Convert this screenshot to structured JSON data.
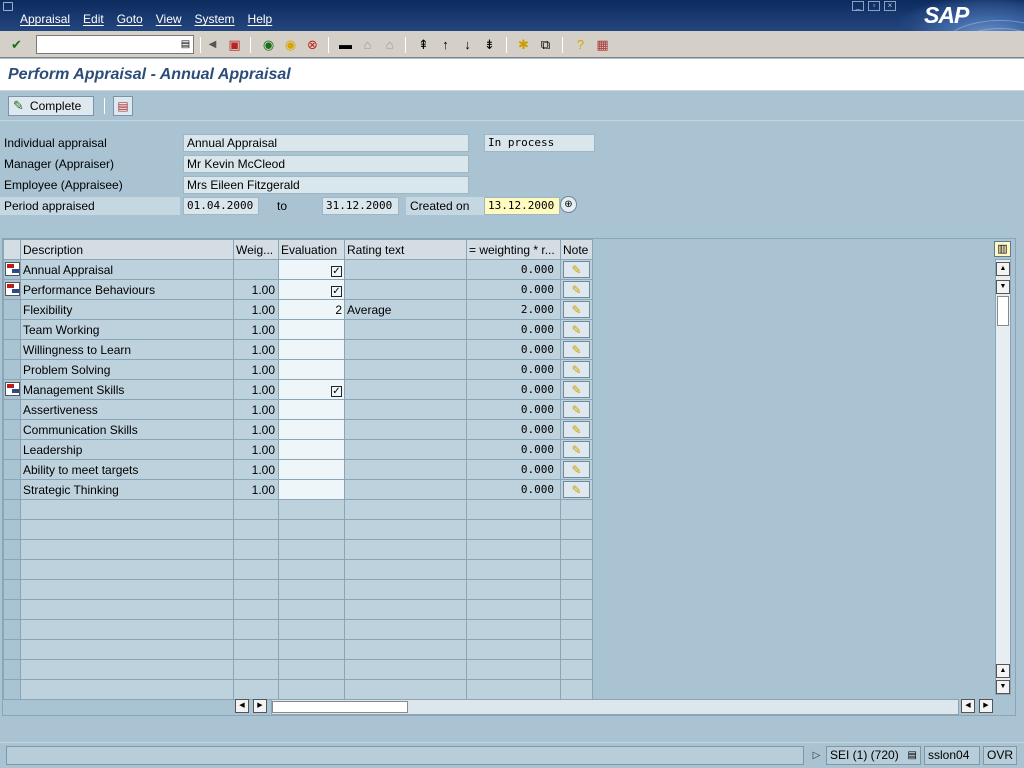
{
  "menubar": {
    "items": [
      "Appraisal",
      "Edit",
      "Goto",
      "View",
      "System",
      "Help"
    ],
    "logo_text": "SAP"
  },
  "toolbar": {
    "command_value": "",
    "icons": [
      "enter-icon",
      "history-icon",
      "back-arrow-icon",
      "save-icon",
      "back-icon",
      "exit-icon",
      "cancel-icon",
      "print-icon",
      "find-icon",
      "find-next-icon",
      "first-page-icon",
      "previous-page-icon",
      "next-page-icon",
      "last-page-icon",
      "create-session-icon",
      "shortcut-icon",
      "help-icon",
      "layout-menu-icon"
    ]
  },
  "title": "Perform Appraisal - Annual Appraisal",
  "app_toolbar": {
    "complete_label": "Complete"
  },
  "header": {
    "individual_appraisal_label": "Individual appraisal",
    "individual_appraisal_value": "Annual Appraisal",
    "status_value": "In process",
    "manager_label": "Manager (Appraiser)",
    "manager_value": "Mr Kevin McCleod",
    "employee_label": "Employee (Appraisee)",
    "employee_value": "Mrs Eileen Fitzgerald",
    "period_label": "Period appraised",
    "period_from": "01.04.2000",
    "to_label": "to",
    "period_to": "31.12.2000",
    "created_on_label": "Created on",
    "created_on_value": "13.12.2000"
  },
  "table": {
    "columns": [
      "Description",
      "Weig...",
      "Evaluation",
      "Rating text",
      "= weighting * r...",
      "Note"
    ],
    "rows": [
      {
        "has_icon": true,
        "description": "Annual Appraisal",
        "weight": "",
        "evaluation": "",
        "eval_check": true,
        "rating_text": "",
        "result": "0.000"
      },
      {
        "has_icon": true,
        "description": "Performance Behaviours",
        "weight": "1.00",
        "evaluation": "",
        "eval_check": true,
        "rating_text": "",
        "result": "0.000"
      },
      {
        "has_icon": false,
        "description": "Flexibility",
        "weight": "1.00",
        "evaluation": "2",
        "eval_check": false,
        "rating_text": "Average",
        "result": "2.000"
      },
      {
        "has_icon": false,
        "description": "Team Working",
        "weight": "1.00",
        "evaluation": "",
        "eval_check": false,
        "rating_text": "",
        "result": "0.000"
      },
      {
        "has_icon": false,
        "description": "Willingness to Learn",
        "weight": "1.00",
        "evaluation": "",
        "eval_check": false,
        "rating_text": "",
        "result": "0.000"
      },
      {
        "has_icon": false,
        "description": "Problem Solving",
        "weight": "1.00",
        "evaluation": "",
        "eval_check": false,
        "rating_text": "",
        "result": "0.000"
      },
      {
        "has_icon": true,
        "description": "Management Skills",
        "weight": "1.00",
        "evaluation": "",
        "eval_check": true,
        "rating_text": "",
        "result": "0.000"
      },
      {
        "has_icon": false,
        "description": "Assertiveness",
        "weight": "1.00",
        "evaluation": "",
        "eval_check": false,
        "rating_text": "",
        "result": "0.000"
      },
      {
        "has_icon": false,
        "description": "Communication Skills",
        "weight": "1.00",
        "evaluation": "",
        "eval_check": false,
        "rating_text": "",
        "result": "0.000"
      },
      {
        "has_icon": false,
        "description": "Leadership",
        "weight": "1.00",
        "evaluation": "",
        "eval_check": false,
        "rating_text": "",
        "result": "0.000"
      },
      {
        "has_icon": false,
        "description": "Ability to meet targets",
        "weight": "1.00",
        "evaluation": "",
        "eval_check": false,
        "rating_text": "",
        "result": "0.000"
      },
      {
        "has_icon": false,
        "description": "Strategic Thinking",
        "weight": "1.00",
        "evaluation": "",
        "eval_check": false,
        "rating_text": "",
        "result": "0.000"
      }
    ],
    "empty_rows": 10
  },
  "statusbar": {
    "message": "",
    "session": "SEI (1) (720)",
    "server": "sslon04",
    "mode": "OVR"
  }
}
